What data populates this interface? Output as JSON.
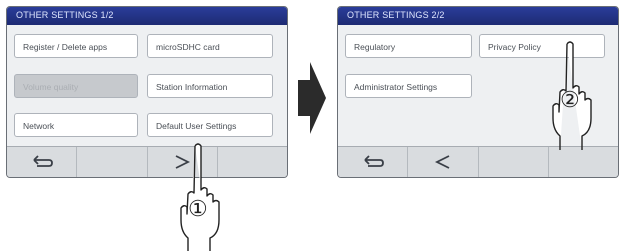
{
  "screen1": {
    "title": "OTHER SETTINGS 1/2",
    "buttons": [
      {
        "label": "Register / Delete apps",
        "enabled": true
      },
      {
        "label": "microSDHC card",
        "enabled": true
      },
      {
        "label": "Volume quality",
        "enabled": false
      },
      {
        "label": "Station Information",
        "enabled": true
      },
      {
        "label": "Network",
        "enabled": true
      },
      {
        "label": "Default User Settings",
        "enabled": true
      }
    ],
    "nav": [
      "back-icon",
      "",
      "next-icon",
      ""
    ]
  },
  "screen2": {
    "title": "OTHER SETTINGS 2/2",
    "buttons": [
      {
        "label": "Regulatory",
        "enabled": true
      },
      {
        "label": "Privacy Policy",
        "enabled": true
      },
      {
        "label": "Administrator Settings",
        "enabled": true
      }
    ],
    "nav": [
      "back-icon",
      "previous-icon",
      "",
      ""
    ]
  },
  "steps": {
    "step1": "①",
    "step2": "②"
  },
  "colors": {
    "title_bar": "#1d2a73",
    "screen_bg": "#eef0f2",
    "button_disabled": "#c6c9cd",
    "flow_arrow": "#2b2b2b"
  },
  "icons": {
    "flow_arrow": "right-arrow-icon",
    "hand": "pointing-hand-icon"
  }
}
